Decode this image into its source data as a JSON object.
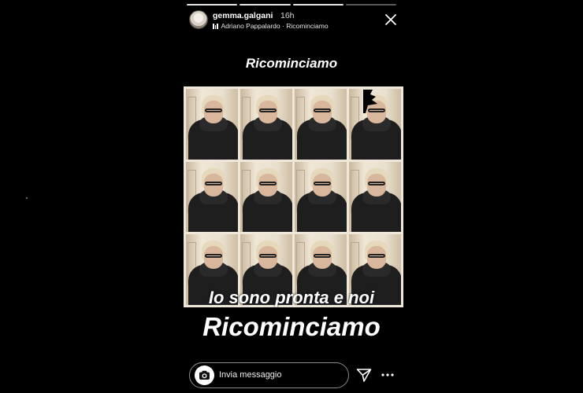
{
  "story": {
    "progress_segments": 4,
    "progress_active": 3,
    "username": "gemma.galgani",
    "time": "16h",
    "music": "Adriano Pappalardo · Ricominciamo",
    "top_caption": "Ricominciamo",
    "caption_line1": "Io sono pronta e noi",
    "caption_line2": "Ricominciamo",
    "collage_rows": 3,
    "collage_cols": 4
  },
  "footer": {
    "reply_placeholder": "Invia messaggio"
  },
  "icons": {
    "close": "close-icon",
    "camera": "camera-icon",
    "send": "send-icon",
    "more": "more-icon",
    "music": "music-bars-icon"
  }
}
